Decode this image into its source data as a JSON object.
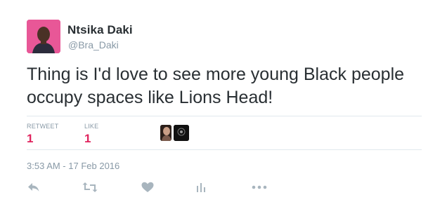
{
  "user": {
    "name": "Ntsika Daki",
    "handle": "@Bra_Daki"
  },
  "tweet": {
    "text": "Thing is I'd love to see more young Black people occupy spaces like Lions Head!",
    "timestamp": "3:53 AM - 17 Feb 2016"
  },
  "stats": {
    "retweet_label": "RETWEET",
    "retweet_count": "1",
    "like_label": "LIKE",
    "like_count": "1"
  },
  "likers": [
    "liker-avatar",
    "liker-avatar"
  ],
  "actions": {
    "icons": [
      "reply-icon",
      "retweet-icon",
      "like-icon",
      "analytics-icon",
      "more-icon"
    ]
  },
  "colors": {
    "accent_count": "#e0245e",
    "muted": "#8899a6",
    "text": "#292f33",
    "divider": "#e1e8ed",
    "icon": "#a8b5be",
    "avatar_bg": "#e64e93"
  }
}
